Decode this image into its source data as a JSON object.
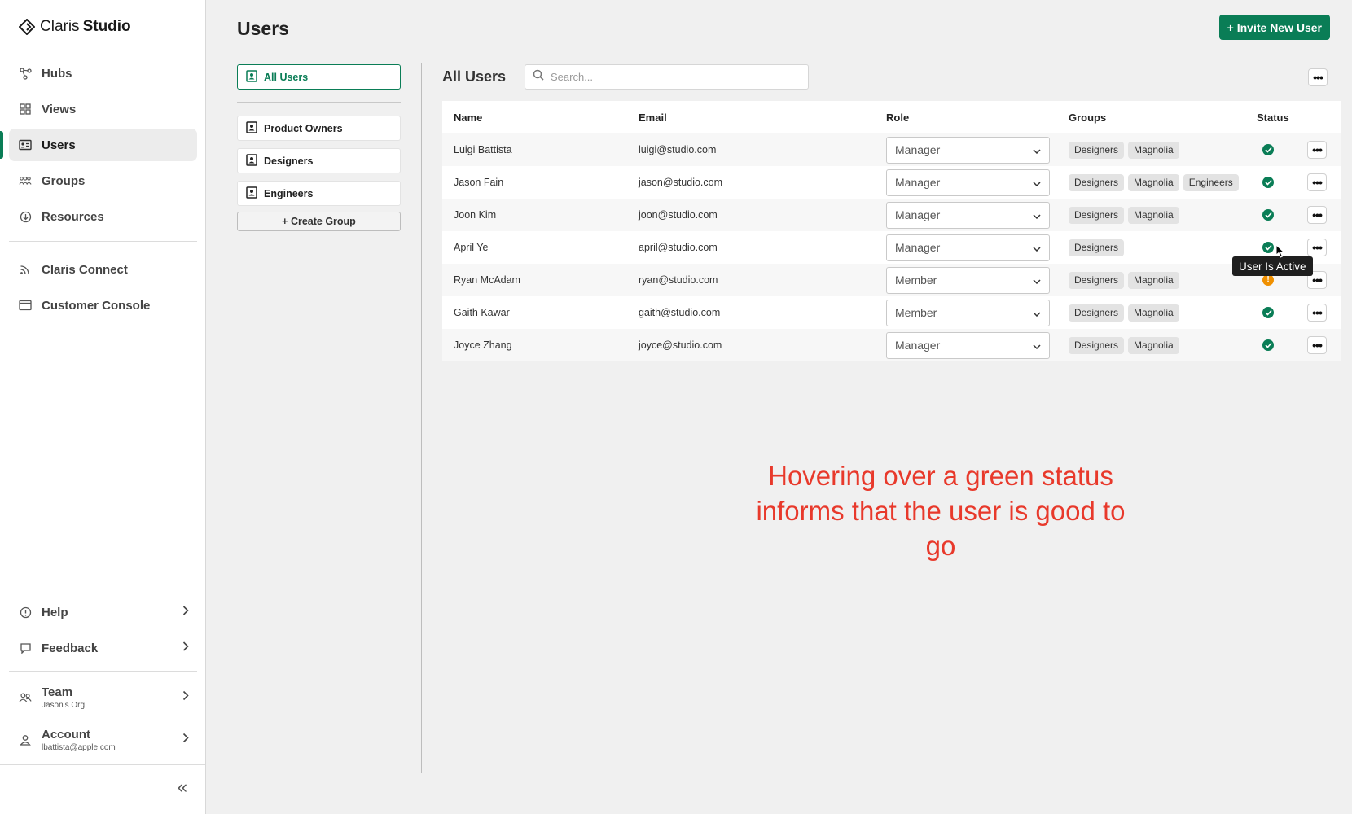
{
  "brand": {
    "light": "Claris",
    "bold": "Studio"
  },
  "sidebar": {
    "items": [
      {
        "label": "Hubs",
        "icon": "hubs-icon"
      },
      {
        "label": "Views",
        "icon": "views-icon"
      },
      {
        "label": "Users",
        "icon": "users-icon"
      },
      {
        "label": "Groups",
        "icon": "groups-icon"
      },
      {
        "label": "Resources",
        "icon": "resources-icon"
      }
    ],
    "secondary": [
      {
        "label": "Claris Connect",
        "icon": "connect-icon"
      },
      {
        "label": "Customer Console",
        "icon": "console-icon"
      }
    ],
    "help": "Help",
    "feedback": "Feedback",
    "team": {
      "label": "Team",
      "sub": "Jason's Org"
    },
    "account": {
      "label": "Account",
      "sub": "lbattista@apple.com"
    },
    "collapse": "«"
  },
  "header": {
    "title": "Users",
    "invite_label": "+ Invite New User"
  },
  "groups_list": {
    "all_users": "All Users",
    "groups": [
      "Product Owners",
      "Designers",
      "Engineers"
    ],
    "create_label": "+ Create Group"
  },
  "panel": {
    "title": "All Users",
    "search_placeholder": "Search..."
  },
  "table": {
    "columns": [
      "Name",
      "Email",
      "Role",
      "Groups",
      "Status"
    ],
    "rows": [
      {
        "name": "Luigi Battista",
        "email": "luigi@studio.com",
        "role": "Manager",
        "groups": [
          "Designers",
          "Magnolia"
        ],
        "status": "active"
      },
      {
        "name": "Jason Fain",
        "email": "jason@studio.com",
        "role": "Manager",
        "groups": [
          "Designers",
          "Magnolia",
          "Engineers"
        ],
        "status": "active"
      },
      {
        "name": "Joon Kim",
        "email": "joon@studio.com",
        "role": "Manager",
        "groups": [
          "Designers",
          "Magnolia"
        ],
        "status": "active"
      },
      {
        "name": "April Ye",
        "email": "april@studio.com",
        "role": "Manager",
        "groups": [
          "Designers"
        ],
        "status": "active"
      },
      {
        "name": "Ryan McAdam",
        "email": "ryan@studio.com",
        "role": "Member",
        "groups": [
          "Designers",
          "Magnolia"
        ],
        "status": "warning"
      },
      {
        "name": "Gaith Kawar",
        "email": "gaith@studio.com",
        "role": "Member",
        "groups": [
          "Designers",
          "Magnolia"
        ],
        "status": "active"
      },
      {
        "name": "Joyce Zhang",
        "email": "joyce@studio.com",
        "role": "Manager",
        "groups": [
          "Designers",
          "Magnolia"
        ],
        "status": "active"
      }
    ]
  },
  "tooltip": "User Is Active",
  "annotation": "Hovering over a green status informs that the user is good to go",
  "colors": {
    "accent": "#0a7d56",
    "warning": "#f09000",
    "annotation": "#e8392b"
  }
}
